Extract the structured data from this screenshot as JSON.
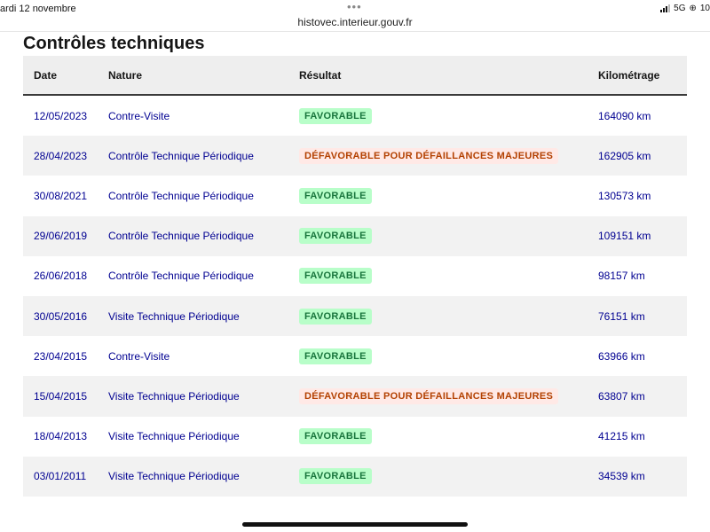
{
  "status_bar": {
    "date": "ardi 12 novembre",
    "dots": "•••",
    "url": "histovec.interieur.gouv.fr",
    "network": "5G",
    "battery_partial": "10",
    "icons": [
      "signal-icon",
      "orientation-lock-icon"
    ]
  },
  "section": {
    "title": "Contrôles techniques"
  },
  "table": {
    "headers": {
      "date": "Date",
      "nature": "Nature",
      "result": "Résultat",
      "km": "Kilométrage"
    },
    "rows": [
      {
        "date": "12/05/2023",
        "nature": "Contre-Visite",
        "result": "FAVORABLE",
        "status": "ok",
        "km": "164090 km"
      },
      {
        "date": "28/04/2023",
        "nature": "Contrôle Technique Périodique",
        "result": "DÉFAVORABLE POUR DÉFAILLANCES MAJEURES",
        "status": "ko",
        "km": "162905 km"
      },
      {
        "date": "30/08/2021",
        "nature": "Contrôle Technique Périodique",
        "result": "FAVORABLE",
        "status": "ok",
        "km": "130573 km"
      },
      {
        "date": "29/06/2019",
        "nature": "Contrôle Technique Périodique",
        "result": "FAVORABLE",
        "status": "ok",
        "km": "109151 km"
      },
      {
        "date": "26/06/2018",
        "nature": "Contrôle Technique Périodique",
        "result": "FAVORABLE",
        "status": "ok",
        "km": "98157 km"
      },
      {
        "date": "30/05/2016",
        "nature": "Visite Technique Périodique",
        "result": "FAVORABLE",
        "status": "ok",
        "km": "76151 km"
      },
      {
        "date": "23/04/2015",
        "nature": "Contre-Visite",
        "result": "FAVORABLE",
        "status": "ok",
        "km": "63966 km"
      },
      {
        "date": "15/04/2015",
        "nature": "Visite Technique Périodique",
        "result": "DÉFAVORABLE POUR DÉFAILLANCES MAJEURES",
        "status": "ko",
        "km": "63807 km"
      },
      {
        "date": "18/04/2013",
        "nature": "Visite Technique Périodique",
        "result": "FAVORABLE",
        "status": "ok",
        "km": "41215 km"
      },
      {
        "date": "03/01/2011",
        "nature": "Visite Technique Périodique",
        "result": "FAVORABLE",
        "status": "ok",
        "km": "34539 km"
      }
    ]
  },
  "colors": {
    "link_text": "#000091",
    "favorable_bg": "#b8fec9",
    "favorable_text": "#18753c",
    "defavorable_bg": "#ffe9e6",
    "defavorable_text": "#b34000"
  }
}
